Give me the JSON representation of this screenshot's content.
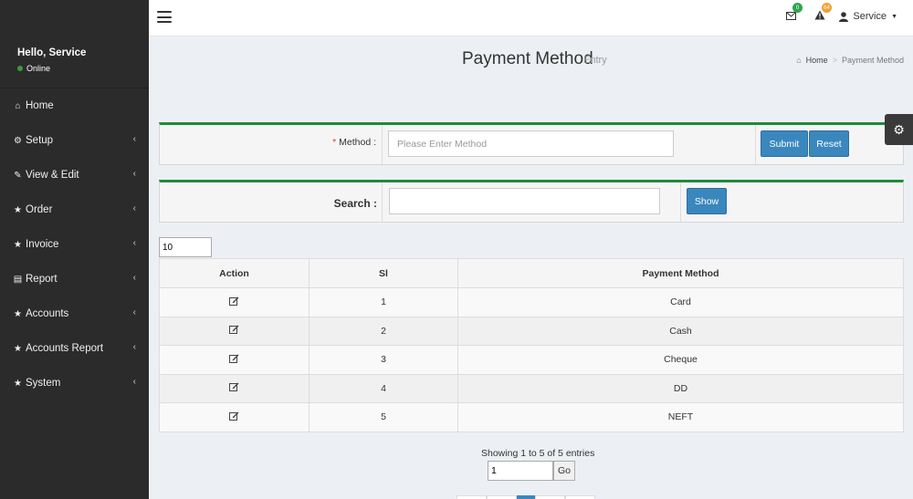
{
  "sidebar": {
    "greeting": "Hello, Service",
    "status": "Online",
    "items": [
      {
        "label": "Home",
        "icon": "home-icon",
        "glyph": "⌂",
        "chevron": false
      },
      {
        "label": "Setup",
        "icon": "cogs-icon",
        "glyph": "⚙",
        "chevron": true
      },
      {
        "label": "View & Edit",
        "icon": "edit-icon",
        "glyph": "✎",
        "chevron": true
      },
      {
        "label": "Order",
        "icon": "star-icon",
        "glyph": "★",
        "chevron": true
      },
      {
        "label": "Invoice",
        "icon": "star-icon",
        "glyph": "★",
        "chevron": true
      },
      {
        "label": "Report",
        "icon": "file-icon",
        "glyph": "▤",
        "chevron": true
      },
      {
        "label": "Accounts",
        "icon": "star-icon",
        "glyph": "★",
        "chevron": true
      },
      {
        "label": "Accounts Report",
        "icon": "star-icon",
        "glyph": "★",
        "chevron": true
      },
      {
        "label": "System",
        "icon": "star-icon",
        "glyph": "★",
        "chevron": true
      }
    ]
  },
  "topbar": {
    "messages_count": "0",
    "alerts_count": "64",
    "user_label": "Service"
  },
  "header": {
    "title": "Payment Method",
    "subtitle": "Entry",
    "breadcrumb_home": "Home",
    "breadcrumb_current": "Payment Method"
  },
  "form": {
    "required_mark": "*",
    "method_label": "Method :",
    "method_placeholder": "Please Enter Method",
    "method_value": "",
    "submit_label": "Submit",
    "reset_label": "Reset"
  },
  "search": {
    "label": "Search :",
    "value": "",
    "show_label": "Show"
  },
  "table": {
    "page_length": "10",
    "headers": [
      "Action",
      "Sl",
      "Payment Method"
    ],
    "rows": [
      {
        "sl": "1",
        "method": "Card"
      },
      {
        "sl": "2",
        "method": "Cash"
      },
      {
        "sl": "3",
        "method": "Cheque"
      },
      {
        "sl": "4",
        "method": "DD"
      },
      {
        "sl": "5",
        "method": "NEFT"
      }
    ]
  },
  "pagination": {
    "info": "Showing 1 to 5 of 5 entries",
    "page_value": "1",
    "go_label": "Go"
  },
  "colors": {
    "sidebar_bg": "#2b2b2b",
    "primary_button": "#3a87bd",
    "box_accent": "#1f8a3c"
  }
}
